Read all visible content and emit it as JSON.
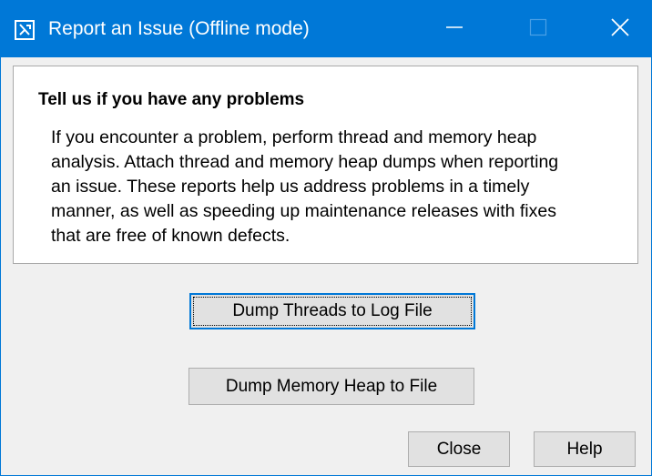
{
  "window": {
    "title": "Report an Issue (Offline mode)",
    "accent_color": "#0078d7",
    "icons": {
      "app": "report-issue-icon",
      "minimize": "minimize-icon",
      "maximize": "maximize-icon",
      "close": "close-icon"
    }
  },
  "info": {
    "heading": "Tell us if you have any problems",
    "lines": [
      "If you encounter a problem, perform thread and memory heap",
      "analysis. Attach thread and memory heap dumps when reporting",
      "an issue. These reports help us address problems in a timely",
      "manner, as well as speeding up maintenance releases with fixes",
      "that are free of known defects."
    ]
  },
  "actions": {
    "dump_threads_label": "Dump Threads to Log File",
    "dump_heap_label": "Dump Memory Heap to File",
    "close_label": "Close",
    "help_label": "Help"
  }
}
